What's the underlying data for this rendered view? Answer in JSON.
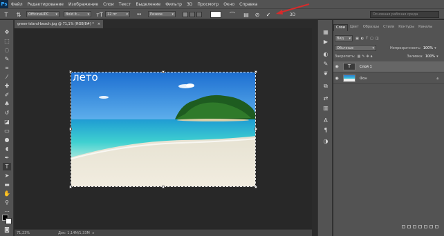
{
  "app": {
    "logo": "Ps"
  },
  "menu": [
    "Файл",
    "Редактирование",
    "Изображение",
    "Слои",
    "Текст",
    "Выделение",
    "Фильтр",
    "3D",
    "Просмотр",
    "Окно",
    "Справка"
  ],
  "options": {
    "font_family": "OfficinaUPC",
    "font_style": "Bold It...",
    "font_size": "12 пт",
    "antialias_label": "aa",
    "antialias": "Резкое",
    "workspace": "Основная рабочая среда"
  },
  "document": {
    "tab_title": "green-island-beach.jpg @ 71,1% (RGB/8#) *",
    "text_layer_content": "лето"
  },
  "status": {
    "zoom": "71,23%",
    "doc_size": "Док: 1,14M/1,33M"
  },
  "panels": {
    "tabs": [
      "Слои",
      "Цвет",
      "Образцы",
      "Стили",
      "Контуры",
      "Каналы"
    ],
    "blend_mode": "Обычные",
    "opacity_label": "Непрозрачность:",
    "opacity": "100%",
    "lock_label": "Закрепить:",
    "fill_label": "Заливка:",
    "fill": "100%",
    "kind_filter": "Вид",
    "layers": [
      {
        "name": "Слой 1",
        "type": "text"
      },
      {
        "name": "Фон",
        "type": "image"
      }
    ]
  },
  "colors": {
    "menubar_bg": "#535353",
    "canvas_bg": "#282828",
    "confirm_arrow": "#d62b2b"
  }
}
